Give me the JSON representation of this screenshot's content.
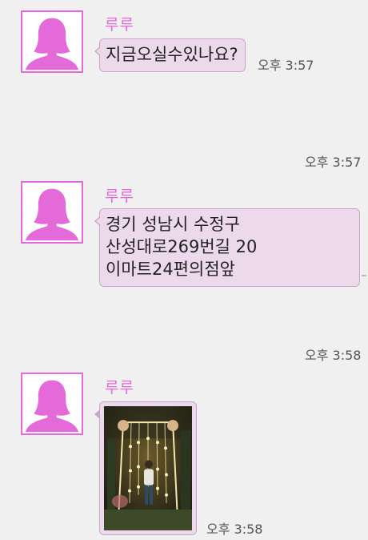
{
  "messages": [
    {
      "sender": "루루",
      "lines": [
        "지금오실수있나요?"
      ],
      "time": "오후 3:57"
    },
    {
      "type": "timestamp_only",
      "time": "오후 3:57"
    },
    {
      "sender": "루루",
      "lines": [
        "경기 성남시 수정구",
        "산성대로269번길 20",
        "이마트24편의점앞"
      ],
      "time": ""
    },
    {
      "type": "timestamp_only",
      "time": "오후 3:58"
    },
    {
      "sender": "루루",
      "type": "image",
      "time": "오후 3:58"
    }
  ],
  "colors": {
    "background": "#f0f0f0",
    "accent_pink": "#e36ad8",
    "bubble_fill": "#ecd9ec",
    "bubble_border": "#c9a6c9"
  },
  "icons": {
    "avatar": "person-silhouette-icon"
  }
}
